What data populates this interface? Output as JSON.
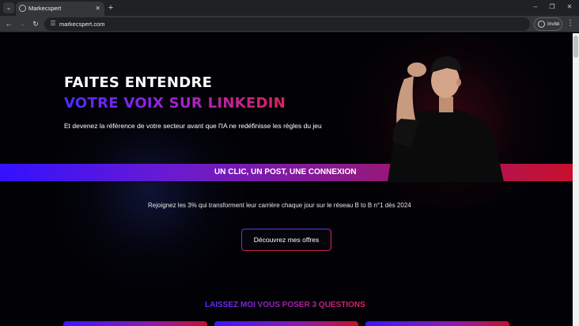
{
  "browser": {
    "tab_title": "Markecspert",
    "url": "markecspert.com",
    "profile_label": "Invité",
    "icons": {
      "tab_menu": "chevron-down-icon",
      "close": "close-icon",
      "new_tab": "plus-icon",
      "back": "arrow-left-icon",
      "forward": "arrow-right-icon",
      "reload": "reload-icon",
      "site_info": "tune-icon",
      "profile": "person-icon",
      "menu": "kebab-icon",
      "minimize": "minimize-icon",
      "restore": "restore-icon",
      "window_close": "close-icon"
    }
  },
  "hero": {
    "title_line1": "FAITES ENTENDRE",
    "title_line2": "VOTRE VOIX SUR LINKEDIN",
    "subtitle": "Et devenez la référence de votre secteur avant que l'IA ne redéfinisse les règles du jeu"
  },
  "banner": {
    "text": "UN CLIC, UN POST, UNE CONNEXION"
  },
  "join": {
    "text": "Rejoignez les 3% qui transforment leur carrière chaque jour sur le réseau B to B n°1 dès 2024",
    "cta_label": "Découvrez mes offres"
  },
  "questions": {
    "title": "LAISSEZ MOI VOUS POSER 3 QUESTIONS"
  },
  "colors": {
    "gradient_start": "#3311ff",
    "gradient_mid": "#8c1a8a",
    "gradient_end": "#c8102e",
    "page_bg": "#020206"
  }
}
